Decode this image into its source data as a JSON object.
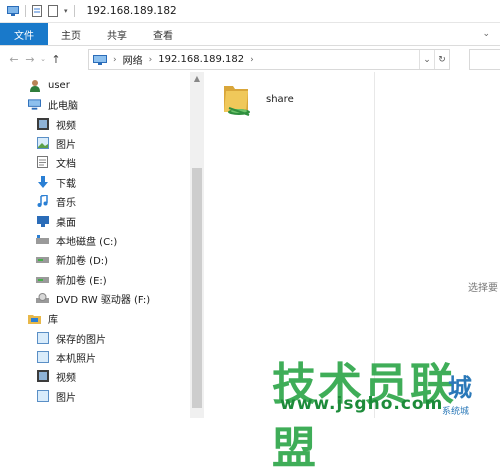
{
  "window": {
    "title": "192.168.189.182"
  },
  "ribbon": {
    "tabs": [
      "文件",
      "主页",
      "共享",
      "查看"
    ]
  },
  "address": {
    "crumbs": [
      "网络",
      "192.168.189.182"
    ]
  },
  "nav": {
    "user": "user",
    "this_pc": "此电脑",
    "pc_items": [
      "视频",
      "图片",
      "文档",
      "下载",
      "音乐",
      "桌面",
      "本地磁盘 (C:)",
      "新加卷 (D:)",
      "新加卷 (E:)",
      "DVD RW 驱动器 (F:)"
    ],
    "library": "库",
    "lib_items": [
      "保存的图片",
      "本机照片",
      "视频",
      "图片"
    ]
  },
  "content": {
    "items": [
      {
        "name": "share",
        "icon": "shared-folder-icon"
      }
    ]
  },
  "preview_hint": "选择要",
  "watermark": {
    "text": "技术员联盟",
    "url": "www.jsgho.com",
    "sub": "城",
    "tag": "系统城"
  },
  "colors": {
    "accent": "#1979ca",
    "folder": "#e8b84a",
    "watermark_green": "#2fa74a"
  }
}
